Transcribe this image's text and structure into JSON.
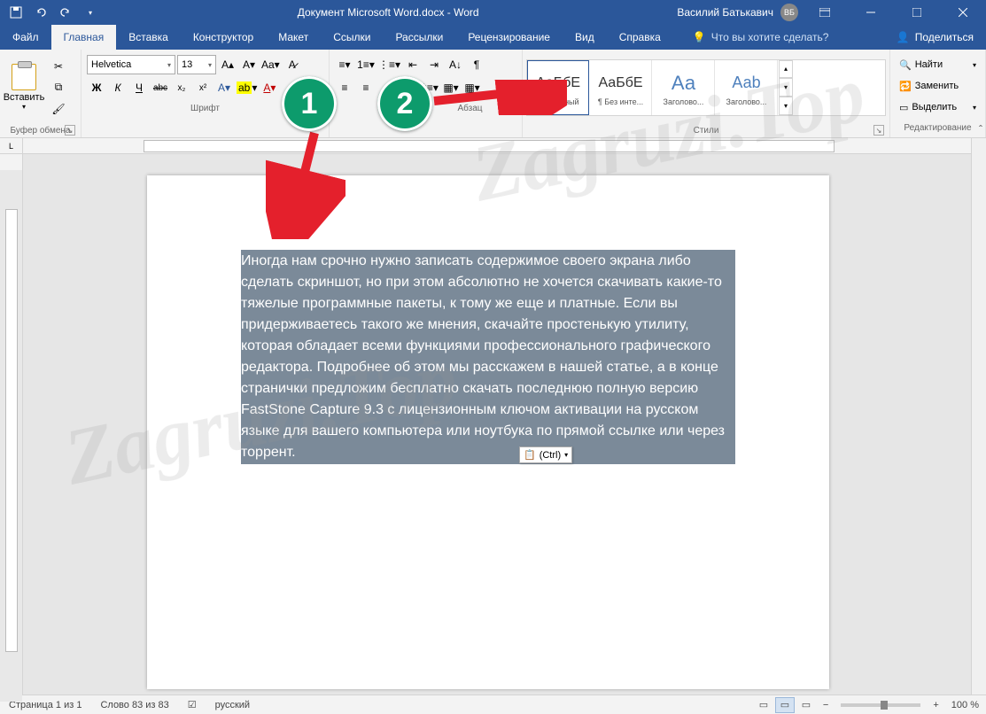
{
  "titlebar": {
    "title": "Документ Microsoft Word.docx - Word",
    "user_name": "Василий Батькавич",
    "user_initials": "ВБ"
  },
  "tabs": {
    "file": "Файл",
    "home": "Главная",
    "insert": "Вставка",
    "design": "Конструктор",
    "layout": "Макет",
    "references": "Ссылки",
    "mailings": "Рассылки",
    "review": "Рецензирование",
    "view": "Вид",
    "help": "Справка",
    "tell_me": "Что вы хотите сделать?",
    "share": "Поделиться"
  },
  "ribbon": {
    "clipboard": {
      "label": "Буфер обмена",
      "paste": "Вставить"
    },
    "font": {
      "label": "Шрифт",
      "name": "Helvetica",
      "size": "13",
      "bold": "Ж",
      "italic": "К",
      "underline": "Ч",
      "strike": "abc",
      "sub": "x₂",
      "sup": "x²"
    },
    "paragraph": {
      "label": "Абзац"
    },
    "styles": {
      "label": "Стили",
      "items": [
        {
          "preview": "АаБбЕ",
          "name": "¶ Обычный"
        },
        {
          "preview": "АаБбЕ",
          "name": "¶ Без инте..."
        },
        {
          "preview": "Аа",
          "name": "Заголово..."
        },
        {
          "preview": "Ааb",
          "name": "Заголово..."
        }
      ]
    },
    "editing": {
      "label": "Редактирование",
      "find": "Найти",
      "replace": "Заменить",
      "select": "Выделить"
    }
  },
  "document": {
    "text": "Иногда нам срочно нужно записать содержимое своего экрана либо сделать скриншот, но при этом абсолютно не хочется скачивать какие-то тяжелые программные пакеты, к тому же еще и платные. Если вы придерживаетесь такого же мнения, скачайте простенькую утилиту, которая обладает всеми функциями профессионального графического редактора. Подробнее об этом мы расскажем в нашей статье, а в конце странички предложим бесплатно скачать последнюю полную версию FastStone Capture 9.3 с лицензионным ключом активации на русском языке для вашего компьютера или ноутбука по прямой ссылке или через торрент.",
    "paste_popup": "(Ctrl)"
  },
  "statusbar": {
    "page": "Страница 1 из 1",
    "words": "Слово 83 из 83",
    "language": "русский",
    "zoom": "100 %"
  },
  "annotations": {
    "b1": "1",
    "b2": "2"
  },
  "watermark": "Zagruzi.Top"
}
